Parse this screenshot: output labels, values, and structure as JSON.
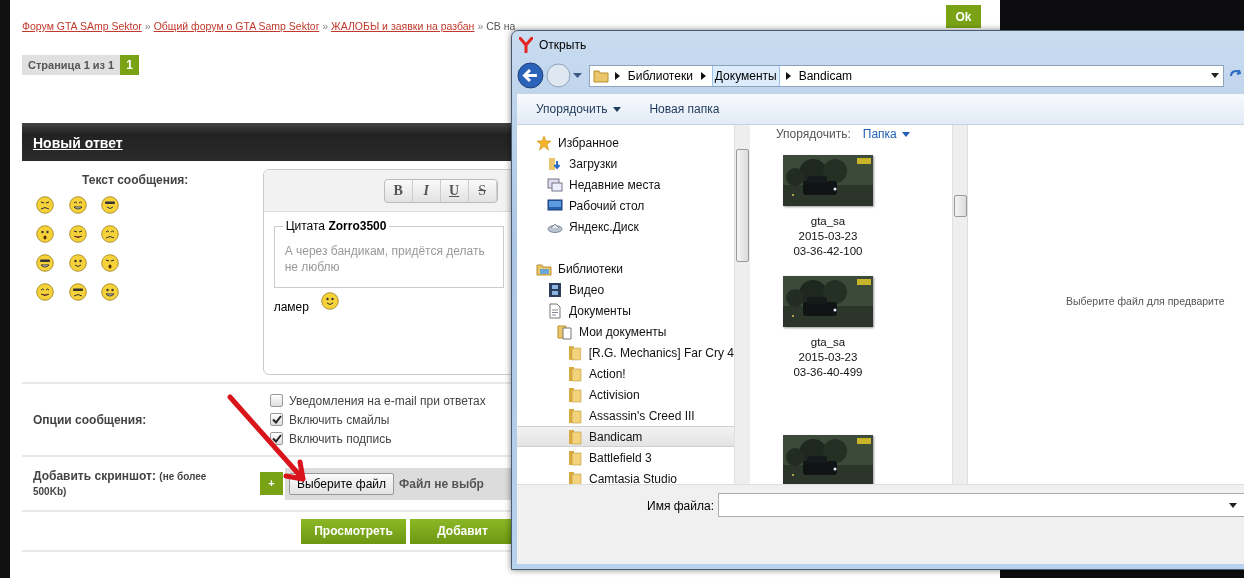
{
  "page": {
    "breadcrumbs": [
      {
        "text": "Форум GTA SAmp Sektor",
        "kind": "link"
      },
      {
        "text": "Общий форум о GTA Samp Sektor",
        "kind": "link"
      },
      {
        "text": "ЖАЛОБЫ и заявки на разбан",
        "kind": "link"
      },
      {
        "text": "СВ на",
        "kind": "current"
      }
    ],
    "separator": "»",
    "ok_button": "Ok",
    "pagination": {
      "label": "Страница 1 из 1",
      "pages": [
        {
          "label": "1",
          "selected": true
        }
      ]
    },
    "reply_header": "Новый ответ",
    "message_label": "Текст сообщения:",
    "editor": {
      "toolbar": [
        {
          "label": "B",
          "kind": "bold"
        },
        {
          "label": "I",
          "kind": "italic"
        },
        {
          "label": "U",
          "kind": "underline"
        },
        {
          "label": "S",
          "kind": "strike"
        }
      ],
      "quote": {
        "title": "Цитата **Zorro3500**",
        "lines": [
          "А через бандикам, придётся делать",
          "не люблю"
        ]
      },
      "body": "ламер"
    },
    "options_label": "Опции сообщения:",
    "options": [
      {
        "label": "Уведомления на e-mail при ответах",
        "checked": false
      },
      {
        "label": "Включить смайлы",
        "checked": true
      },
      {
        "label": "Включить подпись",
        "checked": true
      }
    ],
    "screenshot_label": "Добавить скриншот:",
    "screenshot_note": "(не более 500Kb)",
    "add_button": "+",
    "file_button": "Выберите файл",
    "file_status": "Файл не выбр",
    "buttons": [
      "Просмотреть",
      "Добавит"
    ]
  },
  "dialog": {
    "title": "Открыть",
    "path": [
      {
        "label": "Библиотеки",
        "selected": false
      },
      {
        "label": "Документы",
        "selected": true
      },
      {
        "label": "Bandicam",
        "selected": false
      }
    ],
    "toolbar": [
      {
        "label": "Упорядочить",
        "dropdown": true
      },
      {
        "label": "Новая папка",
        "dropdown": false
      }
    ],
    "tree": [
      {
        "label": "Избранное",
        "kind": "favorites",
        "selected": false,
        "children": [
          {
            "label": "Загрузки",
            "kind": "downloads",
            "selected": false
          },
          {
            "label": "Недавние места",
            "kind": "recent",
            "selected": false
          },
          {
            "label": "Рабочий стол",
            "kind": "desktop",
            "selected": false
          },
          {
            "label": "Яндекс.Диск",
            "kind": "cloud",
            "selected": false
          }
        ]
      },
      {
        "label": "Библиотеки",
        "kind": "libraries",
        "selected": false,
        "children": [
          {
            "label": "Видео",
            "kind": "video",
            "selected": false
          },
          {
            "label": "Документы",
            "kind": "documents",
            "selected": false,
            "children": [
              {
                "label": "Мои документы",
                "kind": "mydocs",
                "selected": false,
                "children": [
                  {
                    "label": "[R.G. Mechanics] Far Cry 4",
                    "kind": "folder",
                    "selected": false
                  },
                  {
                    "label": "Action!",
                    "kind": "folder",
                    "selected": false
                  },
                  {
                    "label": "Activision",
                    "kind": "folder",
                    "selected": false
                  },
                  {
                    "label": "Assassin's Creed III",
                    "kind": "folder",
                    "selected": false
                  },
                  {
                    "label": "Bandicam",
                    "kind": "folder",
                    "selected": true
                  },
                  {
                    "label": "Battlefield 3",
                    "kind": "folder",
                    "selected": false
                  },
                  {
                    "label": "Camtasia Studio",
                    "kind": "folder",
                    "selected": false
                  }
                ]
              }
            ]
          }
        ]
      }
    ],
    "arrange_label": "Упорядочить:",
    "arrange_value": "Папка",
    "files": [
      {
        "kind": "picture",
        "caption": [
          "gta_sa",
          "2015-03-23",
          "03-36-42-100"
        ]
      },
      {
        "kind": "picture",
        "caption": [
          "gta_sa",
          "2015-03-23",
          "03-36-40-499"
        ]
      },
      {
        "kind": "picture"
      }
    ],
    "preview_hint": "Выберите файл для предварите",
    "filename_label": "Имя файла:"
  }
}
